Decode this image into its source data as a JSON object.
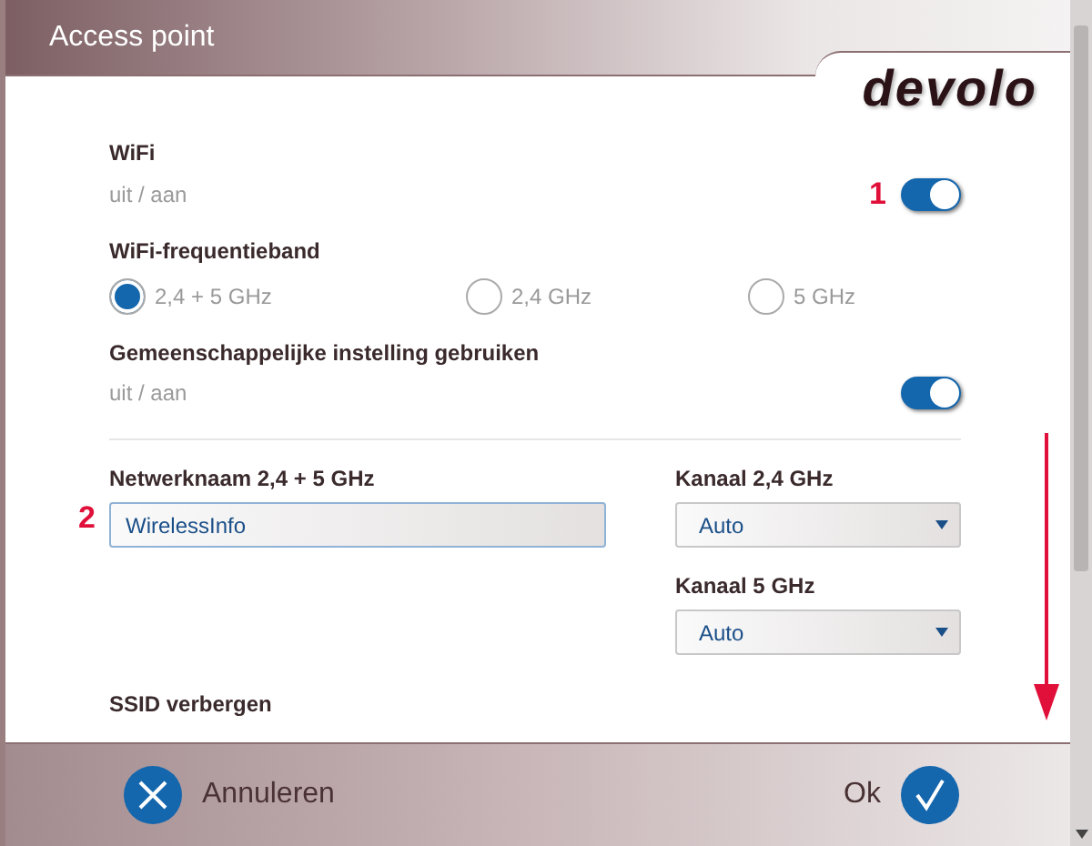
{
  "window": {
    "title": "Access point",
    "logo": "devolo"
  },
  "wifi": {
    "label": "WiFi",
    "hint": "uit / aan",
    "on": true,
    "marker": "1"
  },
  "band": {
    "label": "WiFi-frequentieband",
    "options": [
      {
        "label": "2,4 + 5 GHz",
        "selected": true
      },
      {
        "label": "2,4 GHz",
        "selected": false
      },
      {
        "label": "5 GHz",
        "selected": false
      }
    ]
  },
  "common": {
    "label": "Gemeenschappelijke instelling gebruiken",
    "hint": "uit / aan",
    "on": true
  },
  "network_name": {
    "label": "Netwerknaam 2,4 + 5 GHz",
    "value": "WirelessInfo",
    "marker": "2"
  },
  "channels": [
    {
      "label": "Kanaal 2,4 GHz",
      "value": "Auto"
    },
    {
      "label": "Kanaal 5 GHz",
      "value": "Auto"
    }
  ],
  "ssid": {
    "label": "SSID verbergen"
  },
  "buttons": [
    {
      "kind": "cancel",
      "label": "Annuleren"
    },
    {
      "kind": "ok",
      "label": "Ok"
    }
  ]
}
